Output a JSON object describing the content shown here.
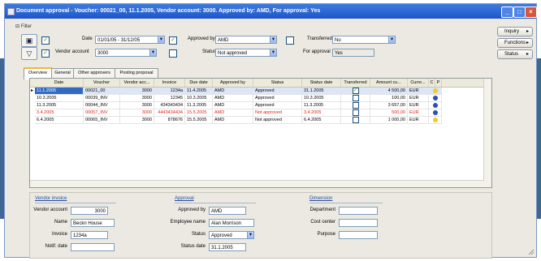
{
  "window": {
    "title": "Document approval - Voucher: 00021_00, 11.1.2005, Vendor account: 3000. Approved by: AMD, For approval: Yes"
  },
  "filter": {
    "toggle_label": "Filter",
    "date_label": "Date",
    "date_value": "01/01/05 - 31/12/05",
    "approved_by_label": "Approved by",
    "approved_by_value": "AMD",
    "transferred_label": "Transferred",
    "transferred_value": "No",
    "vendor_account_label": "Vendor account",
    "vendor_account_value": "3000",
    "status_label": "Status",
    "status_value": "Not approved",
    "for_approval_label": "For approval",
    "for_approval_value": "Yes"
  },
  "side_buttons": [
    {
      "label": "Inquiry"
    },
    {
      "label": "Functions"
    },
    {
      "label": "Status"
    }
  ],
  "tabs": [
    {
      "label": "Overview"
    },
    {
      "label": "General"
    },
    {
      "label": "Other approvers"
    },
    {
      "label": "Posting proposal"
    }
  ],
  "grid": {
    "columns": [
      "Date",
      "Voucher",
      "Vendor acc...",
      "Invoice",
      "Due date",
      "Approved by",
      "Status",
      "Status date",
      "Transferred",
      "Amount cu...",
      "Curre...",
      "C",
      "P"
    ],
    "rows": [
      {
        "date": "11.1.2005",
        "voucher": "00021_00",
        "vendor": "3000",
        "invoice": "1234a",
        "due": "11.4.2005",
        "approved_by": "AMD",
        "status": "Approved",
        "status_date": "31.1.2005",
        "transferred": true,
        "amount": "4 500,00",
        "currency": "EUR",
        "indicator": "stat-yellow"
      },
      {
        "date": "10.3.2005",
        "voucher": "00039_INV",
        "vendor": "3000",
        "invoice": "12345",
        "due": "10.3.2005",
        "approved_by": "AMD",
        "status": "Approved",
        "status_date": "10.3.2005",
        "transferred": false,
        "amount": "100,00",
        "currency": "EUR",
        "indicator": "stat-blue"
      },
      {
        "date": "11.3.2005",
        "voucher": "00044_INV",
        "vendor": "3000",
        "invoice": "434343434",
        "due": "11.3.2005",
        "approved_by": "AMD",
        "status": "Approved",
        "status_date": "11.3.2005",
        "transferred": false,
        "amount": "3 657,00",
        "currency": "EUR",
        "indicator": "stat-blue"
      },
      {
        "date": "3.4.2005",
        "voucher": "00057_INV",
        "vendor": "3000",
        "invoice": "4443434434",
        "due": "15.5.2005",
        "approved_by": "AMD",
        "status": "Not approved",
        "status_date": "3.4.2005",
        "transferred": false,
        "amount": "500,00",
        "currency": "EUR",
        "indicator": "stat-blue",
        "red": true
      },
      {
        "date": "6.4.2005",
        "voucher": "00065_INV",
        "vendor": "3000",
        "invoice": "878676",
        "due": "15.5.2005",
        "approved_by": "AMD",
        "status": "Not approved",
        "status_date": "6.4.2005",
        "transferred": false,
        "amount": "1 000,00",
        "currency": "EUR",
        "indicator": "stat-yellow"
      }
    ]
  },
  "detail": {
    "vendor_invoice_header": "Vendor invoice",
    "vendor_account_label": "Vendor account",
    "vendor_account_value": "3000",
    "name_label": "Name",
    "name_value": "Beckn House",
    "invoice_label": "Invoice",
    "invoice_value": "1234a",
    "notification_label": "Notif. date",
    "notification_value": "",
    "approval_header": "Approval",
    "approved_by_label": "Approved by",
    "approved_by_value": "AMD",
    "employee_name_label": "Employee name",
    "employee_name_value": "Alan Morrison",
    "status_label": "Status",
    "status_value": "Approved",
    "status_date_label": "Status date",
    "status_date_value": "31.1.2005",
    "dimension_header": "Dimension",
    "department_label": "Department",
    "department_value": "",
    "cost_center_label": "Cost center",
    "cost_center_value": "",
    "purpose_label": "Purpose",
    "purpose_value": ""
  },
  "colors": {
    "title_bar": "#1d55c8",
    "selection": "#316ac5",
    "not_approved_text": "#e0261a",
    "background_band": "#3f6695"
  }
}
